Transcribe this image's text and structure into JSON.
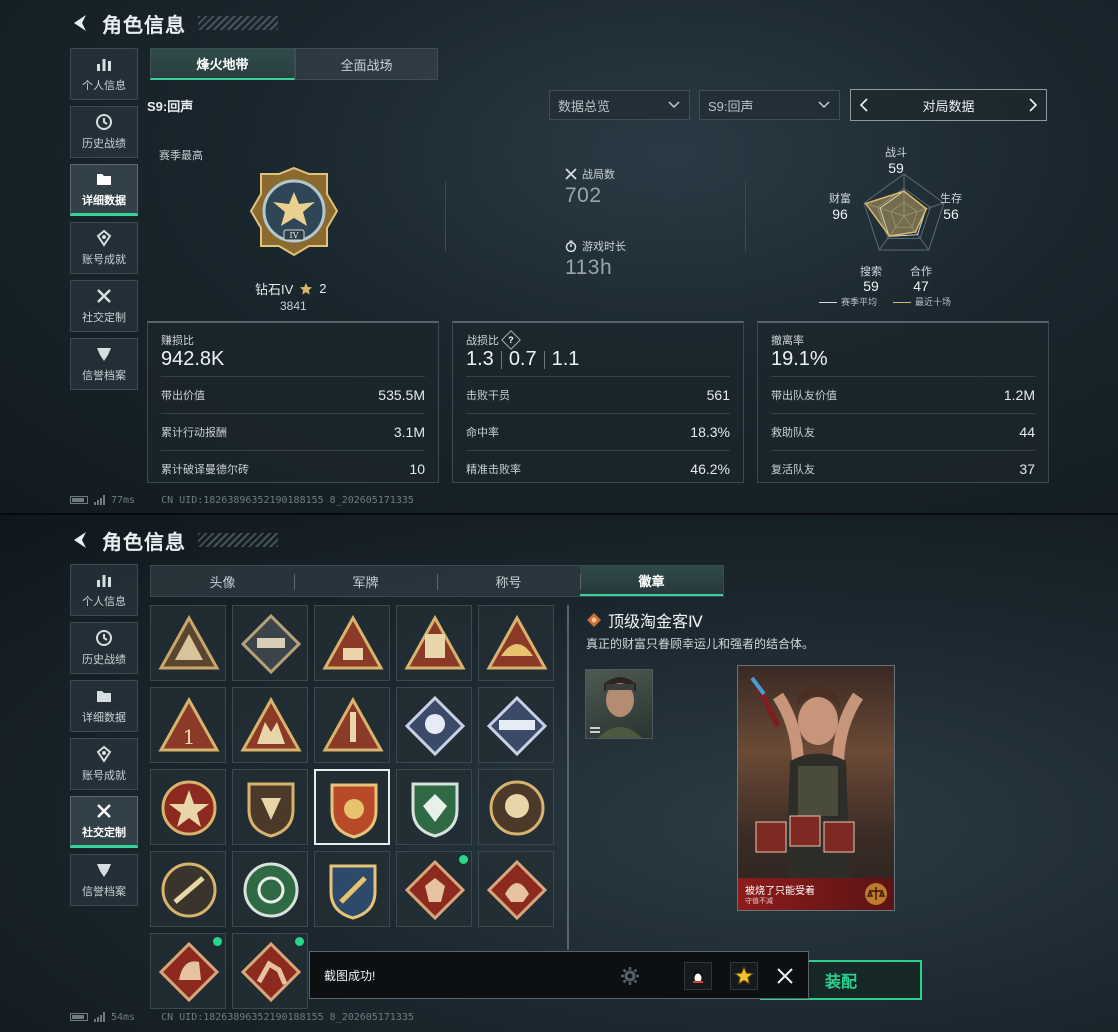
{
  "top": {
    "title": "角色信息",
    "nav": [
      {
        "label": "个人信息",
        "icon": "bar-chart-icon"
      },
      {
        "label": "历史战绩",
        "icon": "clock-icon"
      },
      {
        "label": "详细数据",
        "icon": "folder-icon",
        "active": true
      },
      {
        "label": "账号成就",
        "icon": "medal-icon"
      },
      {
        "label": "社交定制",
        "icon": "tools-icon"
      },
      {
        "label": "信誉档案",
        "icon": "shield-icon"
      }
    ],
    "tabs": [
      "烽火地带",
      "全面战场"
    ],
    "season": "S9:回声",
    "select_overview": "数据总览",
    "select_season": "S9:回声",
    "pager_label": "对局数据",
    "season_high": "赛季最高",
    "rank_name": "钻石IV",
    "rank_stars": "2",
    "rank_score": "3841",
    "matches_label": "战局数",
    "matches_value": "702",
    "playtime_label": "游戏时长",
    "playtime_value": "113h",
    "radar": {
      "labels": [
        "战斗",
        "生存",
        "合作",
        "搜索",
        "财富"
      ],
      "values": [
        "59",
        "56",
        "47",
        "59",
        "96"
      ],
      "legend_avg": "赛季平均",
      "legend_recent": "最近十场"
    },
    "card1": {
      "head": "赚损比",
      "big": "942.8K",
      "rows": [
        {
          "label": "带出价值",
          "value": "535.5M"
        },
        {
          "label": "累计行动报酬",
          "value": "3.1M"
        },
        {
          "label": "累计破译曼德尔砖",
          "value": "10"
        }
      ]
    },
    "card2": {
      "head": "战损比",
      "qmark": "?",
      "big": [
        "1.3",
        "0.7",
        "1.1"
      ],
      "rows": [
        {
          "label": "击败干员",
          "value": "561"
        },
        {
          "label": "命中率",
          "value": "18.3%"
        },
        {
          "label": "精准击败率",
          "value": "46.2%"
        }
      ]
    },
    "card3": {
      "head": "撤离率",
      "big": "19.1%",
      "rows": [
        {
          "label": "带出队友价值",
          "value": "1.2M"
        },
        {
          "label": "救助队友",
          "value": "44"
        },
        {
          "label": "复活队友",
          "value": "37"
        }
      ]
    },
    "status_ping": "77ms",
    "status_uid": "CN UID:18263896352190188155 8_202605171335"
  },
  "bottom": {
    "title": "角色信息",
    "nav": [
      {
        "label": "个人信息"
      },
      {
        "label": "历史战绩"
      },
      {
        "label": "详细数据"
      },
      {
        "label": "账号成就"
      },
      {
        "label": "社交定制",
        "active": true
      },
      {
        "label": "信誉档案"
      }
    ],
    "tabs": [
      "头像",
      "军牌",
      "称号",
      "徽章"
    ],
    "detail_title": "顶级淘金客Ⅳ",
    "detail_desc": "真正的财富只眷顾幸运儿和强者的结合体。",
    "art_caption": "被烧了只能受着",
    "art_subcaption": "守值不减",
    "equip_label": "装配",
    "toast_text": "截图成功!",
    "status_ping": "54ms",
    "status_uid": "CN UID:18263896352190188155 8_202605171335"
  },
  "colors": {
    "accent": "#37d39b",
    "gold": "#d9b86a",
    "badge_red": "#8c2a20"
  }
}
